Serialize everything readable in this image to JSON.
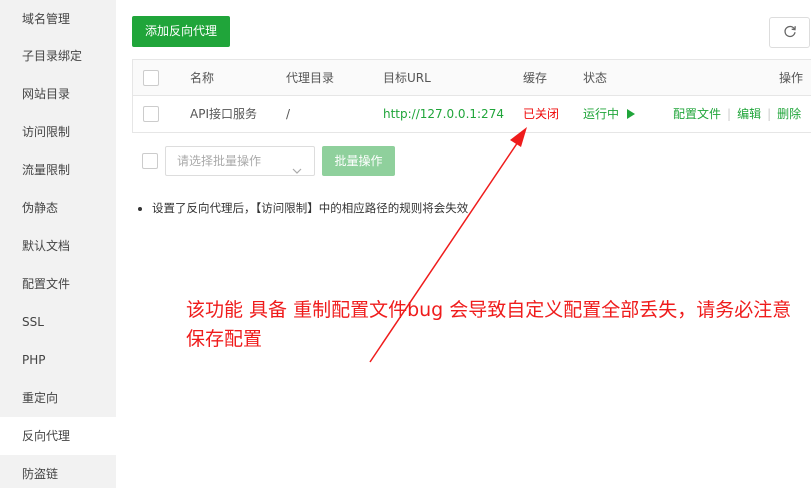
{
  "sidebar": {
    "items": [
      {
        "label": "域名管理"
      },
      {
        "label": "子目录绑定"
      },
      {
        "label": "网站目录"
      },
      {
        "label": "访问限制"
      },
      {
        "label": "流量限制"
      },
      {
        "label": "伪静态"
      },
      {
        "label": "默认文档"
      },
      {
        "label": "配置文件"
      },
      {
        "label": "SSL"
      },
      {
        "label": "PHP"
      },
      {
        "label": "重定向"
      },
      {
        "label": "反向代理"
      },
      {
        "label": "防盗链"
      }
    ],
    "active": "反向代理"
  },
  "toolbar": {
    "add_label": "添加反向代理",
    "refresh_icon": "refresh-icon"
  },
  "table": {
    "headers": {
      "name": "名称",
      "proxy_dir": "代理目录",
      "target_url": "目标URL",
      "cache": "缓存",
      "status": "状态",
      "ops": "操作"
    },
    "rows": [
      {
        "name": "API接口服务",
        "proxy_dir": "/",
        "target_url": "http://127.0.0.1:274",
        "cache": "已关闭",
        "status": "运行中",
        "status_icon": "play-icon",
        "op_config": "配置文件",
        "op_edit": "编辑",
        "op_delete": "删除"
      }
    ]
  },
  "batch": {
    "placeholder": "请选择批量操作",
    "button": "批量操作"
  },
  "tip": "设置了反向代理后，【访问限制】中的相应路径的规则将会失效",
  "annotation": "该功能 具备 重制配置文件bug 会导致自定义配置全部丢失，请务必注意保存配置",
  "colors": {
    "accent": "#20a53a",
    "danger": "#ef0808",
    "annotation": "#ef1c1c"
  }
}
